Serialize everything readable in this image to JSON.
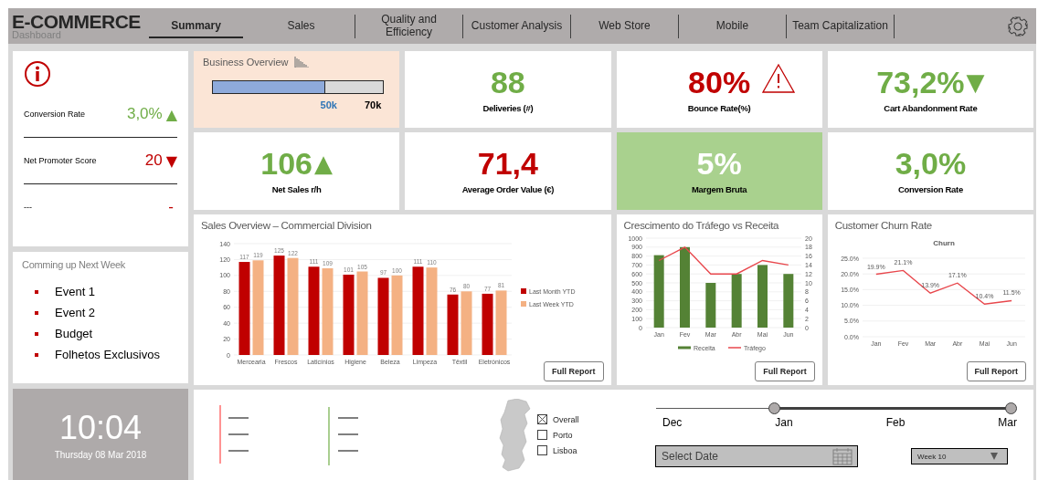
{
  "header": {
    "logo": "E-COMMERCE",
    "subtitle": "Dashboard",
    "tabs": [
      {
        "label": "Summary",
        "selected": true
      },
      {
        "label": "Sales",
        "selected": false
      },
      {
        "label": "Quality and Efficiency",
        "selected": false
      },
      {
        "label": "Customer Analysis",
        "selected": false
      },
      {
        "label": "Web Store",
        "selected": false
      },
      {
        "label": "Mobile",
        "selected": false
      },
      {
        "label": "Team Capitalization",
        "selected": false
      }
    ]
  },
  "alerts": {
    "metrics": [
      {
        "label": "Conversion Rate",
        "value": "3,0%",
        "color": "#70ad47",
        "arrow": "▲"
      },
      {
        "label": "Net Promoter Score",
        "value": "20",
        "color": "#c00000",
        "arrow": "▼"
      },
      {
        "label": "---",
        "value": "-",
        "color": "#c00000"
      }
    ]
  },
  "upcoming": {
    "title": "Comming up Next Week",
    "items": [
      "Event 1",
      "Event 2",
      "Budget",
      "Folhetos Exclusivos"
    ]
  },
  "clock": {
    "time": "10:04",
    "date": "Thursday 08 Mar 2018"
  },
  "business_overview": {
    "title": "Business Overview",
    "level": 0.66,
    "current": "50k",
    "target": "70k"
  },
  "kpis": [
    {
      "value": "88",
      "label": "Deliveries (#)",
      "color": "#70ad47",
      "kind": "plain"
    },
    {
      "value": "80%",
      "label": "Bounce Rate(%)",
      "color": "#c00000",
      "kind": "alert"
    },
    {
      "value": "73,2%",
      "label": "Cart Abandonment Rate",
      "color": "#70ad47",
      "arrow": "▼",
      "kind": "plain"
    },
    {
      "value": "106",
      "label": "Net Sales r/h",
      "color": "#70ad47",
      "arrow": "▲",
      "kind": "plain"
    },
    {
      "value": "71,4",
      "label": "Average Order Value (€)",
      "color": "#c00000",
      "kind": "plain"
    },
    {
      "value": "5%",
      "label": "Margem Bruta",
      "color": "#ffffff",
      "kind": "highlight"
    },
    {
      "value": "3,0%",
      "label": "Conversion Rate",
      "color": "#70ad47",
      "kind": "plain"
    }
  ],
  "sales_overview": {
    "title": "Sales Overview – Commercial Division",
    "button": "Full Report",
    "chart_data": {
      "type": "bar",
      "categories": [
        "Mercearia",
        "Frescos",
        "Laticínios",
        "Higiene",
        "Beleza",
        "Limpeza",
        "Têxtil",
        "Eletrónicos"
      ],
      "series": [
        {
          "name": "Last Month YTD",
          "color": "#c00000",
          "values": [
            117,
            125,
            111,
            101,
            97,
            111,
            76,
            77
          ]
        },
        {
          "name": "Last Week YTD",
          "color": "#f4b183",
          "values": [
            119,
            122,
            109,
            105,
            100,
            110,
            80,
            81
          ]
        }
      ],
      "ylim": [
        0,
        140
      ],
      "yticks": [
        0,
        20,
        40,
        60,
        80,
        100,
        120,
        140
      ],
      "grid": true,
      "legend": "right",
      "stacked": false,
      "data_labels": true
    }
  },
  "traffic": {
    "title": "Crescimento do Tráfego vs Receita",
    "button": "Full Report",
    "chart_data": {
      "type": "bar",
      "categories": [
        "Jan",
        "Fev",
        "Mar",
        "Abr",
        "Mai",
        "Jun"
      ],
      "series": [
        {
          "name": "Receita",
          "color": "#548235",
          "type": "bar",
          "values": [
            810,
            900,
            500,
            600,
            700,
            600
          ]
        },
        {
          "name": "Tráfego",
          "color": "#e8474c",
          "type": "line",
          "axis": "y2",
          "values": [
            15,
            18,
            12,
            12,
            15,
            14
          ]
        }
      ],
      "ylim": [
        0,
        1000
      ],
      "yticks": [
        0,
        100,
        200,
        300,
        400,
        500,
        600,
        700,
        800,
        900,
        1000
      ],
      "y2lim": [
        0,
        20
      ],
      "y2ticks": [
        0,
        2,
        4,
        6,
        8,
        10,
        12,
        14,
        16,
        18,
        20
      ],
      "grid": true,
      "legend": "bottom"
    }
  },
  "churn": {
    "title": "Customer Churn Rate",
    "button": "Full Report",
    "chart_data": {
      "type": "line",
      "legend": "top",
      "x": [
        "Jan",
        "Fev",
        "Mar",
        "Abr",
        "Mai",
        "Jun"
      ],
      "series": [
        {
          "name": "Churn",
          "color": "#e8474c",
          "values": [
            19.9,
            21.1,
            13.9,
            17.1,
            10.4,
            11.5
          ]
        }
      ],
      "ylim": [
        0,
        25
      ],
      "yticks": [
        {
          "value": 0,
          "label": "0.0%"
        },
        {
          "value": 5,
          "label": "5.0%"
        },
        {
          "value": 10,
          "label": "10.0%"
        },
        {
          "value": 15,
          "label": "15.0%"
        },
        {
          "value": 20,
          "label": "20.0%"
        },
        {
          "value": 25,
          "label": "25.0%"
        }
      ],
      "grid": true,
      "value_labels": [
        "19.9%",
        "21.1%",
        "13.9%",
        "17.1%",
        "10.4%",
        "11.5%"
      ]
    }
  },
  "filters": {
    "regions": [
      {
        "label": "Overall",
        "checked": true
      },
      {
        "label": "Porto",
        "checked": false
      },
      {
        "label": "Lisboa",
        "checked": false
      }
    ],
    "range": {
      "labels": [
        "Dec",
        "Jan",
        "Feb",
        "Mar"
      ],
      "thumbs": [
        {
          "level": 0.333
        },
        {
          "level": 1
        }
      ]
    },
    "date_field": {
      "placeholder": "Select Date"
    },
    "week_select": {
      "value": "Week 10"
    }
  }
}
